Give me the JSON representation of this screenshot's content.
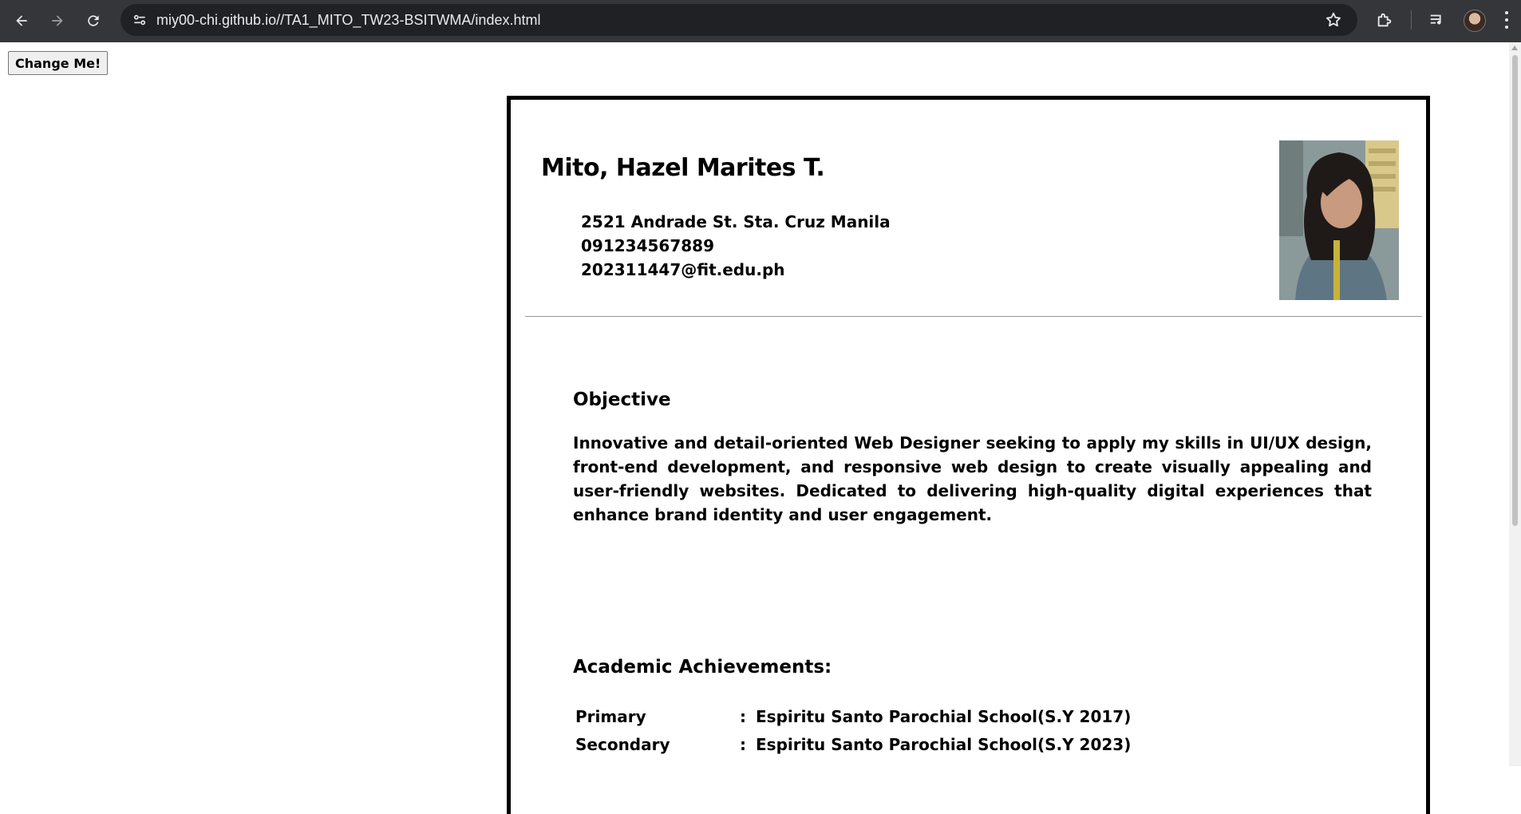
{
  "browser": {
    "url": "miy00-chi.github.io//TA1_MITO_TW23-BSITWMA/index.html",
    "icons": [
      "back-arrow-icon",
      "forward-arrow-icon",
      "reload-icon",
      "site-info-icon",
      "bookmark-star-icon",
      "extensions-icon",
      "media-controls-icon",
      "profile-avatar",
      "menu-dots-icon"
    ]
  },
  "page": {
    "change_button": "Change Me!",
    "name": "Mito, Hazel Marites T.",
    "contact": {
      "address": "2521 Andrade St. Sta. Cruz Manila",
      "phone": "091234567889",
      "email": "202311447@fit.edu.ph"
    },
    "objective": {
      "title": "Objective",
      "text": "Innovative and detail-oriented Web Designer seeking to apply my skills in UI/UX design, front-end development, and responsive web design to create visually appealing and user-friendly websites. Dedicated to delivering high-quality digital experiences that enhance brand identity and user engagement."
    },
    "achievements": {
      "title": "Academic Achievements:",
      "rows": [
        {
          "level": "Primary",
          "colon": ":",
          "school": "Espiritu Santo Parochial School(S.Y 2017)"
        },
        {
          "level": "Secondary",
          "colon": ":",
          "school": "Espiritu Santo Parochial School(S.Y 2023)"
        }
      ]
    }
  }
}
